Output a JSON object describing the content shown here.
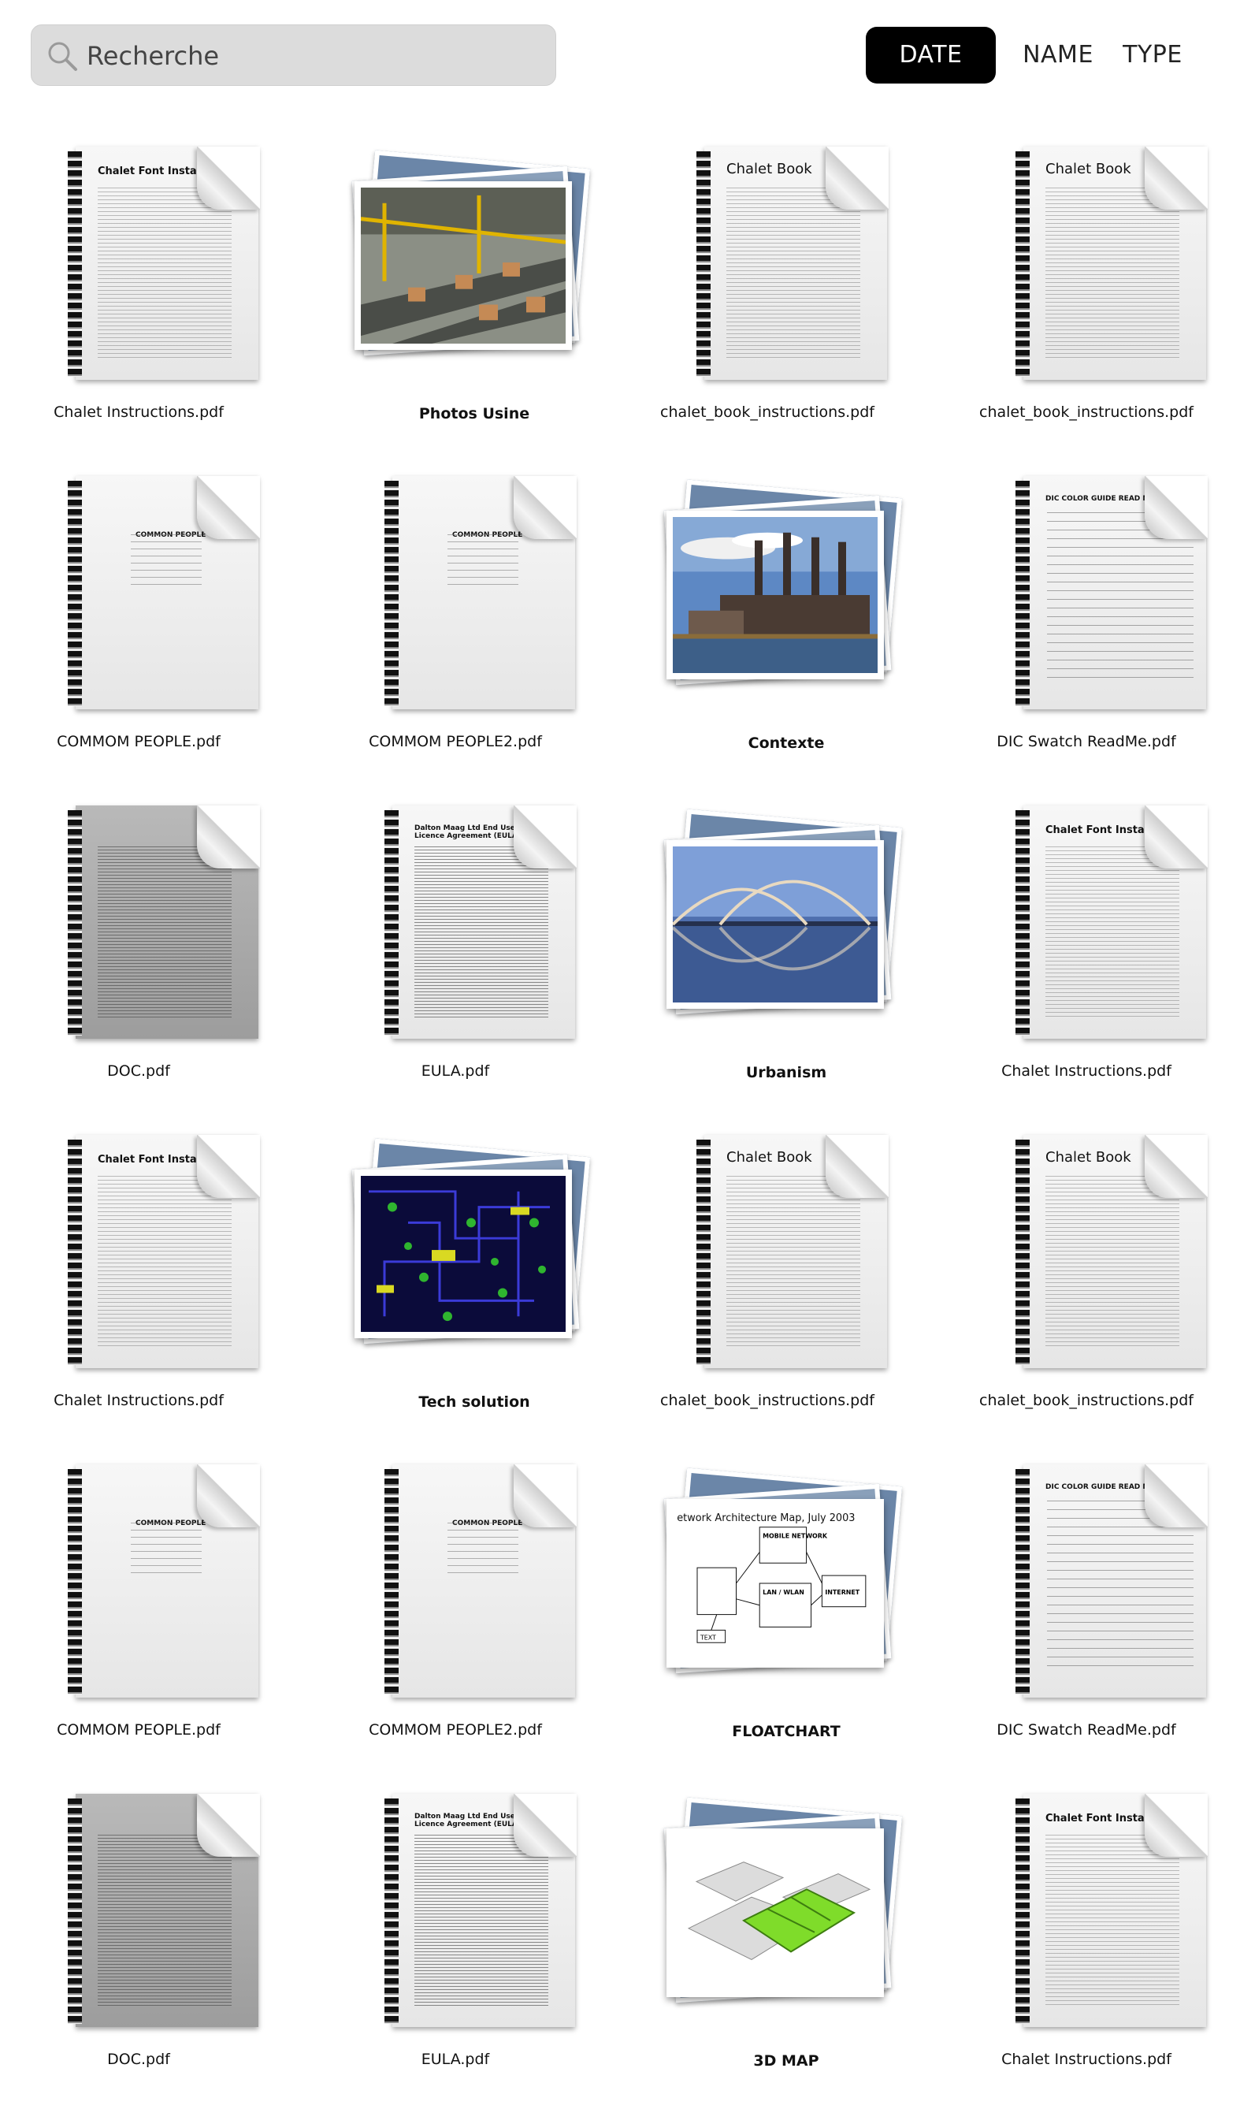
{
  "search": {
    "placeholder": "Recherche"
  },
  "sort": {
    "date": "DATE",
    "name": "NAME",
    "type": "TYPE"
  },
  "items": [
    {
      "label": "Chalet Instructions.pdf",
      "kind": "document",
      "style": "chalet-font",
      "doc_title": "Chalet Font Installation"
    },
    {
      "label": "Photos Usine",
      "kind": "folder",
      "scene": "factory"
    },
    {
      "label": "chalet_book_instructions.pdf",
      "kind": "document",
      "style": "chalet-book",
      "doc_title": "Chalet Book"
    },
    {
      "label": "chalet_book_instructions.pdf",
      "kind": "document",
      "style": "chalet-book",
      "doc_title": "Chalet Book"
    },
    {
      "label": "COMMOM PEOPLE.pdf",
      "kind": "document",
      "style": "sparse",
      "doc_title": "COMMON PEOPLE"
    },
    {
      "label": "COMMOM PEOPLE2.pdf",
      "kind": "document",
      "style": "sparse",
      "doc_title": "COMMON PEOPLE"
    },
    {
      "label": "Contexte",
      "kind": "folder",
      "scene": "power-plant"
    },
    {
      "label": "DIC Swatch ReadMe.pdf",
      "kind": "document",
      "style": "list",
      "doc_title": "DIC COLOR GUIDE READ ME"
    },
    {
      "label": "DOC.pdf",
      "kind": "document",
      "style": "dark",
      "doc_title": ""
    },
    {
      "label": "EULA.pdf",
      "kind": "document",
      "style": "dense",
      "doc_title": "Dalton Maag Ltd End User Licence Agreement (EULA)"
    },
    {
      "label": "Urbanism",
      "kind": "folder",
      "scene": "bridge"
    },
    {
      "label": "Chalet Instructions.pdf",
      "kind": "document",
      "style": "chalet-font",
      "doc_title": "Chalet Font Installation"
    },
    {
      "label": "Chalet Instructions.pdf",
      "kind": "document",
      "style": "chalet-font",
      "doc_title": "Chalet Font Installation"
    },
    {
      "label": "Tech solution",
      "kind": "folder",
      "scene": "circuit"
    },
    {
      "label": "chalet_book_instructions.pdf",
      "kind": "document",
      "style": "chalet-book",
      "doc_title": "Chalet Book"
    },
    {
      "label": "chalet_book_instructions.pdf",
      "kind": "document",
      "style": "chalet-book",
      "doc_title": "Chalet Book"
    },
    {
      "label": "COMMOM PEOPLE.pdf",
      "kind": "document",
      "style": "sparse",
      "doc_title": "COMMON PEOPLE"
    },
    {
      "label": "COMMOM PEOPLE2.pdf",
      "kind": "document",
      "style": "sparse",
      "doc_title": "COMMON PEOPLE"
    },
    {
      "label": "FLOATCHART",
      "kind": "folder",
      "scene": "diagram",
      "diagram_text": [
        "etwork Architecture Map, July 2003",
        "MOBILE NETWORK",
        "INTERNET",
        "LAN / WLAN",
        "TEXT"
      ]
    },
    {
      "label": "DIC Swatch ReadMe.pdf",
      "kind": "document",
      "style": "list",
      "doc_title": "DIC COLOR GUIDE READ ME"
    },
    {
      "label": "DOC.pdf",
      "kind": "document",
      "style": "dark",
      "doc_title": ""
    },
    {
      "label": "EULA.pdf",
      "kind": "document",
      "style": "dense",
      "doc_title": "Dalton Maag Ltd End User Licence Agreement (EULA)"
    },
    {
      "label": "3D MAP",
      "kind": "folder",
      "scene": "3d-map"
    },
    {
      "label": "Chalet Instructions.pdf",
      "kind": "document",
      "style": "chalet-font",
      "doc_title": "Chalet Font Installation"
    }
  ]
}
